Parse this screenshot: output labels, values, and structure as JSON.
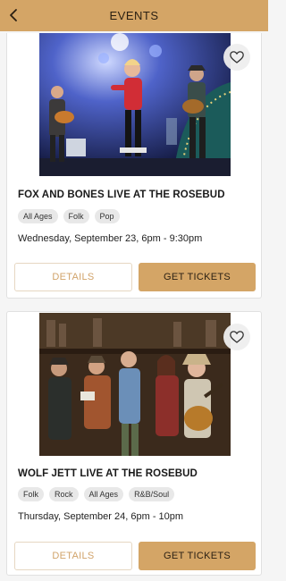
{
  "header": {
    "title": "EVENTS",
    "back_icon": "chevron-left-icon"
  },
  "events": [
    {
      "title": "FOX AND BONES LIVE AT THE ROSEBUD",
      "tags": [
        "All Ages",
        "Folk",
        "Pop"
      ],
      "date": "Wednesday, September 23, 6pm - 9:30pm",
      "details_label": "DETAILS",
      "tickets_label": "GET TICKETS",
      "favorite_icon": "heart-outline-icon",
      "image": "band-live-on-stage-photo"
    },
    {
      "title": "WOLF JETT LIVE AT THE ROSEBUD",
      "tags": [
        "Folk",
        "Rock",
        "All Ages",
        "R&B/Soul"
      ],
      "date": "Thursday, September 24, 6pm - 10pm",
      "details_label": "DETAILS",
      "tickets_label": "GET TICKETS",
      "favorite_icon": "heart-outline-icon",
      "image": "band-group-portrait-photo"
    }
  ],
  "colors": {
    "accent": "#d4a566",
    "details_text": "#d1a36a",
    "background": "#f5f5f5"
  }
}
